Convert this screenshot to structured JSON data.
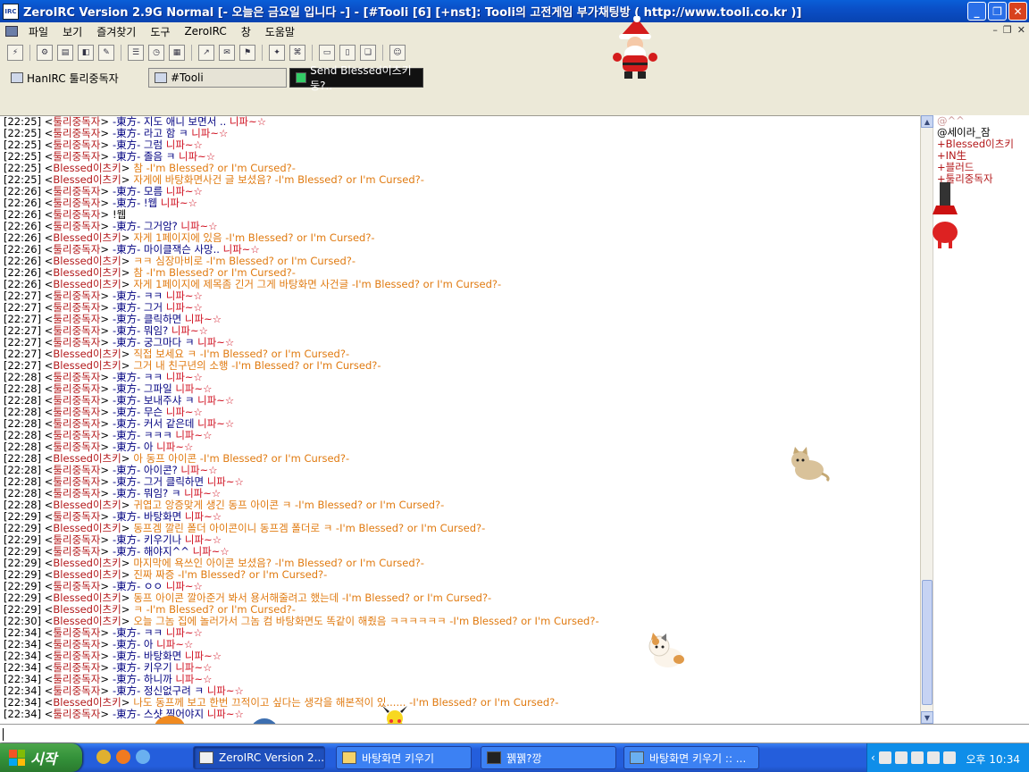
{
  "window": {
    "title": "ZeroIRC Version 2.9G Normal [- 오늘은 금요일 입니다 -] - [#Tooli [6] [+nst]: Tooli의 고전게임 부가채팅방 ( http://www.tooli.co.kr )]",
    "app_icon_text": "IRC"
  },
  "menu": [
    "파일",
    "보기",
    "즐겨찾기",
    "도구",
    "ZeroIRC",
    "창",
    "도움말"
  ],
  "tabs": {
    "server": "HanIRC 툴리중독자",
    "channel": "#Tooli",
    "dcc": "Send Blessed이츠키 둥?.."
  },
  "chat_lines": [
    {
      "t": "[22:25]",
      "n": "툴리중독자",
      "m": "-東方- 지도 애니 보면서 ..",
      "s": " 니파~☆",
      "c": "blue"
    },
    {
      "t": "[22:25]",
      "n": "툴리중독자",
      "m": "-東方- 라고 함 ㅋ",
      "s": " 니파~☆",
      "c": "blue"
    },
    {
      "t": "[22:25]",
      "n": "툴리중독자",
      "m": "-東方- 그럼",
      "s": " 니파~☆",
      "c": "blue"
    },
    {
      "t": "[22:25]",
      "n": "툴리중독자",
      "m": "-東方- 졸음 ㅋ",
      "s": " 니파~☆",
      "c": "blue"
    },
    {
      "t": "[22:25]",
      "n": "Blessed이츠키",
      "m": "참 -I'm Blessed? or I'm Cursed?-",
      "s": "",
      "c": "orange"
    },
    {
      "t": "[22:25]",
      "n": "Blessed이츠키",
      "m": "자게에 바탕화면사건 글 보셨음? -I'm Blessed? or I'm Cursed?-",
      "s": "",
      "c": "orange"
    },
    {
      "t": "[22:26]",
      "n": "툴리중독자",
      "m": "-東方- 모름",
      "s": " 니파~☆",
      "c": "blue"
    },
    {
      "t": "[22:26]",
      "n": "툴리중독자",
      "m": "-東方- !웹",
      "s": " 니파~☆",
      "c": "blue"
    },
    {
      "t": "[22:26]",
      "n": "툴리중독자",
      "m": "!웹",
      "s": "",
      "c": "black"
    },
    {
      "t": "[22:26]",
      "n": "툴리중독자",
      "m": "-東方- 그거암?",
      "s": " 니파~☆",
      "c": "blue"
    },
    {
      "t": "[22:26]",
      "n": "Blessed이츠키",
      "m": "자게 1페이지에 있음 -I'm Blessed? or I'm Cursed?-",
      "s": "",
      "c": "orange"
    },
    {
      "t": "[22:26]",
      "n": "툴리중독자",
      "m": "-東方- 마이클잭슨 사망..",
      "s": " 니파~☆",
      "c": "blue"
    },
    {
      "t": "[22:26]",
      "n": "Blessed이츠키",
      "m": "ㅋㅋ 심장마비로 -I'm Blessed? or I'm Cursed?-",
      "s": "",
      "c": "orange"
    },
    {
      "t": "[22:26]",
      "n": "Blessed이츠키",
      "m": "참 -I'm Blessed? or I'm Cursed?-",
      "s": "",
      "c": "orange"
    },
    {
      "t": "[22:26]",
      "n": "Blessed이츠키",
      "m": "자게 1페이지에 제목좀 긴거 그게 바탕화면 사건글 -I'm Blessed? or I'm Cursed?-",
      "s": "",
      "c": "orange"
    },
    {
      "t": "[22:27]",
      "n": "툴리중독자",
      "m": "-東方- ㅋㅋ",
      "s": " 니파~☆",
      "c": "blue"
    },
    {
      "t": "[22:27]",
      "n": "툴리중독자",
      "m": "-東方- 그거",
      "s": " 니파~☆",
      "c": "blue"
    },
    {
      "t": "[22:27]",
      "n": "툴리중독자",
      "m": "-東方- 클릭하면",
      "s": " 니파~☆",
      "c": "blue"
    },
    {
      "t": "[22:27]",
      "n": "툴리중독자",
      "m": "-東方- 뭐임?",
      "s": " 니파~☆",
      "c": "blue"
    },
    {
      "t": "[22:27]",
      "n": "툴리중독자",
      "m": "-東方- 궁그마다 ㅋ",
      "s": " 니파~☆",
      "c": "blue"
    },
    {
      "t": "[22:27]",
      "n": "Blessed이츠키",
      "m": "직접 보세요 ㅋ -I'm Blessed? or I'm Cursed?-",
      "s": "",
      "c": "orange"
    },
    {
      "t": "[22:27]",
      "n": "Blessed이츠키",
      "m": "그거 내 친구년의 소행 -I'm Blessed? or I'm Cursed?-",
      "s": "",
      "c": "orange"
    },
    {
      "t": "[22:28]",
      "n": "툴리중독자",
      "m": "-東方- ㅋㅋ",
      "s": " 니파~☆",
      "c": "blue"
    },
    {
      "t": "[22:28]",
      "n": "툴리중독자",
      "m": "-東方- 그파일",
      "s": " 니파~☆",
      "c": "blue"
    },
    {
      "t": "[22:28]",
      "n": "툴리중독자",
      "m": "-東方- 보내주샤 ㅋ",
      "s": " 니파~☆",
      "c": "blue"
    },
    {
      "t": "[22:28]",
      "n": "툴리중독자",
      "m": "-東方- 무슨",
      "s": " 니파~☆",
      "c": "blue"
    },
    {
      "t": "[22:28]",
      "n": "툴리중독자",
      "m": "-東方- 커서 같은데",
      "s": " 니파~☆",
      "c": "blue"
    },
    {
      "t": "[22:28]",
      "n": "툴리중독자",
      "m": "-東方- ㅋㅋㅋ",
      "s": " 니파~☆",
      "c": "blue"
    },
    {
      "t": "[22:28]",
      "n": "툴리중독자",
      "m": "-東方- 아",
      "s": " 니파~☆",
      "c": "blue"
    },
    {
      "t": "[22:28]",
      "n": "Blessed이츠키",
      "m": "아 동프 아이콘 -I'm Blessed? or I'm Cursed?-",
      "s": "",
      "c": "orange"
    },
    {
      "t": "[22:28]",
      "n": "툴리중독자",
      "m": "-東方- 아이콘?",
      "s": " 니파~☆",
      "c": "blue"
    },
    {
      "t": "[22:28]",
      "n": "툴리중독자",
      "m": "-東方- 그거 클릭하면",
      "s": " 니파~☆",
      "c": "blue"
    },
    {
      "t": "[22:28]",
      "n": "툴리중독자",
      "m": "-東方- 뭐임? ㅋ",
      "s": " 니파~☆",
      "c": "blue"
    },
    {
      "t": "[22:28]",
      "n": "Blessed이츠키",
      "m": "귀엽고 앙증맞게 생긴 동프 아이콘 ㅋ -I'm Blessed? or I'm Cursed?-",
      "s": "",
      "c": "orange"
    },
    {
      "t": "[22:29]",
      "n": "툴리중독자",
      "m": "-東方- 바탕화면",
      "s": " 니파~☆",
      "c": "blue"
    },
    {
      "t": "[22:29]",
      "n": "Blessed이츠키",
      "m": "동프겜 깔린 폴더 아이콘이니 동프겜 폴더로 ㅋ -I'm Blessed? or I'm Cursed?-",
      "s": "",
      "c": "orange"
    },
    {
      "t": "[22:29]",
      "n": "툴리중독자",
      "m": "-東方- 키우기나",
      "s": " 니파~☆",
      "c": "blue"
    },
    {
      "t": "[22:29]",
      "n": "툴리중독자",
      "m": "-東方- 해야지^^",
      "s": " 니파~☆",
      "c": "blue"
    },
    {
      "t": "[22:29]",
      "n": "Blessed이츠키",
      "m": "마지막에 욕쓰인 아이콘 보셨음? -I'm Blessed? or I'm Cursed?-",
      "s": "",
      "c": "orange"
    },
    {
      "t": "[22:29]",
      "n": "Blessed이츠키",
      "m": "진짜 짜증 -I'm Blessed? or I'm Cursed?-",
      "s": "",
      "c": "orange"
    },
    {
      "t": "[22:29]",
      "n": "툴리중독자",
      "m": "-東方- ㅇㅇ",
      "s": " 니파~☆",
      "c": "blue"
    },
    {
      "t": "[22:29]",
      "n": "Blessed이츠키",
      "m": "동프 아이콘 깔아준거 봐서 용서해줄려고 했는데 -I'm Blessed? or I'm Cursed?-",
      "s": "",
      "c": "orange"
    },
    {
      "t": "[22:29]",
      "n": "Blessed이츠키",
      "m": "ㅋ -I'm Blessed? or I'm Cursed?-",
      "s": "",
      "c": "orange"
    },
    {
      "t": "[22:30]",
      "n": "Blessed이츠키",
      "m": "오늘 그놈 집에 놀러가서 그놈 컴 바탕화면도 똑같이 해줬음 ㅋㅋㅋㅋㅋㅋ -I'm Blessed? or I'm Cursed?-",
      "s": "",
      "c": "orange"
    },
    {
      "t": "[22:34]",
      "n": "툴리중독자",
      "m": "-東方- ㅋㅋ",
      "s": " 니파~☆",
      "c": "blue"
    },
    {
      "t": "[22:34]",
      "n": "툴리중독자",
      "m": "-東方- 아",
      "s": " 니파~☆",
      "c": "blue"
    },
    {
      "t": "[22:34]",
      "n": "툴리중독자",
      "m": "-東方- 바탕화면",
      "s": " 니파~☆",
      "c": "blue"
    },
    {
      "t": "[22:34]",
      "n": "툴리중독자",
      "m": "-東方- 키우기",
      "s": " 니파~☆",
      "c": "blue"
    },
    {
      "t": "[22:34]",
      "n": "툴리중독자",
      "m": "-東方- 하니까",
      "s": " 니파~☆",
      "c": "blue"
    },
    {
      "t": "[22:34]",
      "n": "툴리중독자",
      "m": "-東方- 정신없구려 ㅋ",
      "s": " 니파~☆",
      "c": "blue"
    },
    {
      "t": "[22:34]",
      "n": "Blessed이츠키",
      "m": "나도 동프께 보고 한번 끄적이고 싶다는 생각을 해본적이 있...... -I'm Blessed? or I'm Cursed?-",
      "s": "",
      "c": "orange"
    },
    {
      "t": "[22:34]",
      "n": "툴리중독자",
      "m": "-東方- 스샷 찍어야지",
      "s": " 니파~☆",
      "c": "blue"
    }
  ],
  "nicklist": [
    {
      "name": "@^^",
      "cls": "op"
    },
    {
      "name": "@세이라_잠",
      "cls": ""
    },
    {
      "name": "+Blessed이츠키",
      "cls": "voice"
    },
    {
      "name": "+IN生",
      "cls": "voice"
    },
    {
      "name": "+블러드",
      "cls": "voice"
    },
    {
      "name": "+툴리중독자",
      "cls": "voice"
    }
  ],
  "taskbar": {
    "start_label": "시작",
    "tasks": [
      {
        "label": "ZeroIRC Version 2...",
        "active": true
      },
      {
        "label": "바탕화면 키우기",
        "active": false
      },
      {
        "label": "꿹꿹?깡",
        "active": false
      },
      {
        "label": "바탕화면 키우기 :: ...",
        "active": false
      }
    ],
    "clock": "오후 10:34"
  },
  "colors": {
    "titlebar": "#0a4fc7",
    "timestamp": "#000000",
    "nick": "#b3181a",
    "msg_blue": "#000080",
    "msg_orange": "#e07a10",
    "signature": "#d01020"
  }
}
